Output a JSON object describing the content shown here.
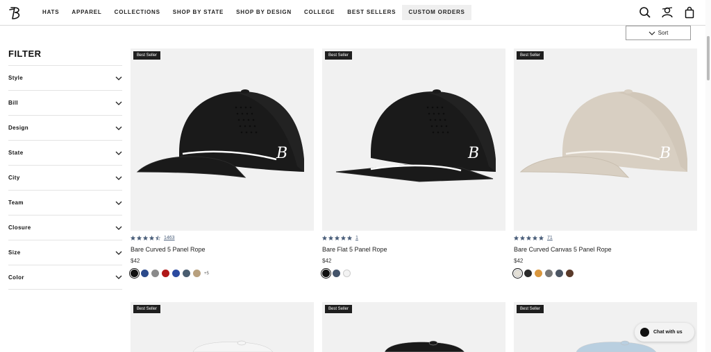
{
  "nav": {
    "items": [
      "HATS",
      "APPAREL",
      "COLLECTIONS",
      "SHOP BY STATE",
      "SHOP BY DESIGN",
      "COLLEGE",
      "BEST SELLERS",
      "CUSTOM ORDERS"
    ],
    "icons": [
      "search-icon",
      "account-icon",
      "bag-icon"
    ]
  },
  "sort": {
    "label": "Sort"
  },
  "filter": {
    "title": "FILTER",
    "items": [
      "Style",
      "Bill",
      "Design",
      "State",
      "City",
      "Team",
      "Closure",
      "Size",
      "Color"
    ]
  },
  "products": [
    {
      "badge": "Best Seller",
      "name": "Bare Curved 5 Panel Rope",
      "price": "$42",
      "rating": 4.5,
      "reviews": "1463",
      "cap_color": "#1a1a1a",
      "bill": "curved",
      "swatches": [
        "#111111",
        "#2b4a8b",
        "#8a8a8a",
        "#b01818",
        "#2a4aa0",
        "#4a5d70",
        "#b8a07e"
      ],
      "more": "+5"
    },
    {
      "badge": "Best Seller",
      "name": "Bare Flat 5 Panel Rope",
      "price": "$42",
      "rating": 5,
      "reviews": "1",
      "cap_color": "#1a1a1a",
      "bill": "flat",
      "swatches": [
        "#111111",
        "#44546a",
        "#f3f3f3"
      ],
      "more": ""
    },
    {
      "badge": "Best Seller",
      "name": "Bare Curved Canvas 5 Panel Rope",
      "price": "$42",
      "rating": 5,
      "reviews": "71",
      "cap_color": "#d8cfc2",
      "bill": "curved",
      "swatches": [
        "#e4e0d6",
        "#2a2a2a",
        "#d9973e",
        "#777777",
        "#4b5563",
        "#5a3a2a"
      ],
      "more": ""
    }
  ],
  "products_row2": [
    {
      "badge": "Best Seller",
      "cap_color": "#f5f5f5"
    },
    {
      "badge": "Best Seller",
      "cap_color": "#1a1a1a"
    },
    {
      "badge": "Best Seller",
      "cap_color": "#b9cfe0"
    }
  ],
  "chat": {
    "label": "Chat with us"
  },
  "colors": {
    "star": "#4a5e7a",
    "badge_bg": "#1f1f1f",
    "card_bg": "#f1f1f1"
  }
}
